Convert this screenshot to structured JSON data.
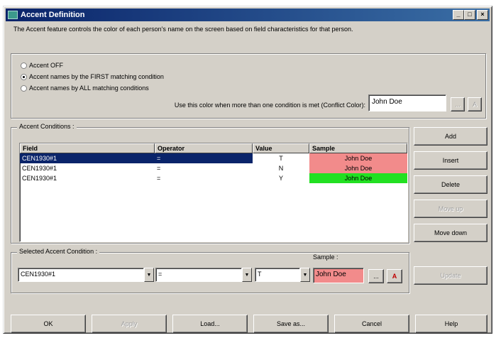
{
  "window": {
    "title": "Accent Definition",
    "controls": [
      "_",
      "□",
      "×"
    ]
  },
  "description": "The Accent feature controls the color of each person's name on the screen based on field characteristics for that person.",
  "radios": [
    {
      "label": "Accent OFF",
      "selected": false
    },
    {
      "label": "Accent names by the FIRST matching condition",
      "selected": true
    },
    {
      "label": "Accent names by ALL matching conditions",
      "selected": false
    }
  ],
  "conflict": {
    "label": "Use this color when more than one condition is met (Conflict Color):",
    "sample": "John Doe",
    "color_button": "...",
    "a_button": "A"
  },
  "conditions": {
    "group_label": "Accent Conditions :",
    "columns": [
      "Field",
      "Operator",
      "Value",
      "Sample"
    ],
    "rows": [
      {
        "field": "CEN1930#1",
        "operator": "=",
        "value": "T",
        "sample": "John Doe",
        "color": "#f28b8b",
        "selected": true
      },
      {
        "field": "CEN1930#1",
        "operator": "=",
        "value": "N",
        "sample": "John Doe",
        "color": "#f28b8b",
        "selected": false
      },
      {
        "field": "CEN1930#1",
        "operator": "=",
        "value": "Y",
        "sample": "John Doe",
        "color": "#22e022",
        "selected": false
      }
    ]
  },
  "side_buttons": {
    "add": "Add",
    "insert": "Insert",
    "delete": "Delete",
    "move_up": "Move up",
    "move_down": "Move down"
  },
  "selected": {
    "group_label": "Selected Accent Condition :",
    "field": "CEN1930#1",
    "operator": "=",
    "value": "T",
    "sample_label": "Sample :",
    "sample": "John Doe",
    "sample_color": "#f28b8b",
    "color_button": "...",
    "a_button": "A",
    "update": "Update"
  },
  "bottom_buttons": {
    "ok": "OK",
    "apply": "Apply",
    "load": "Load...",
    "save_as": "Save as...",
    "cancel": "Cancel",
    "help": "Help"
  },
  "colors": {
    "title_bar": "#0a246a",
    "selection": "#0a246a",
    "face": "#d4d0c8"
  }
}
